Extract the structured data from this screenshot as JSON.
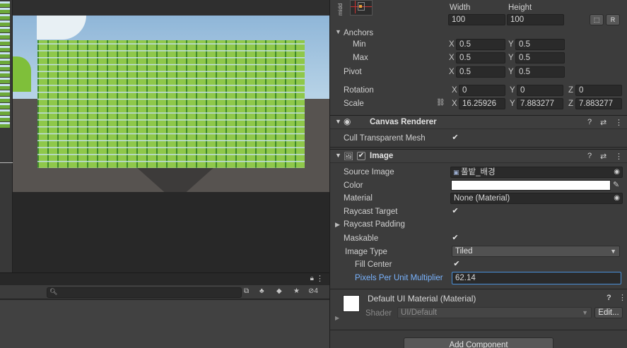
{
  "inspector": {
    "anchor_preset": {
      "label": "midd"
    },
    "rect": {
      "width_label": "Width",
      "height_label": "Height",
      "width": "100",
      "height": "100",
      "blueprint_button": "⬚",
      "raw_button": "R"
    },
    "anchors": {
      "label": "Anchors",
      "min_label": "Min",
      "min_x": "0.5",
      "min_y": "0.5",
      "max_label": "Max",
      "max_x": "0.5",
      "max_y": "0.5"
    },
    "pivot": {
      "label": "Pivot",
      "x": "0.5",
      "y": "0.5"
    },
    "rotation": {
      "label": "Rotation",
      "x": "0",
      "y": "0",
      "z": "0"
    },
    "scale": {
      "label": "Scale",
      "x": "16.25926",
      "y": "7.883277",
      "z": "7.883277"
    },
    "axes": {
      "x": "X",
      "y": "Y",
      "z": "Z"
    },
    "canvas_renderer": {
      "title": "Canvas Renderer",
      "cull_label": "Cull Transparent Mesh",
      "cull_checked": true
    },
    "image": {
      "title": "Image",
      "enabled": true,
      "source_image_label": "Source Image",
      "source_image_value": "풀밭_배경",
      "color_label": "Color",
      "color_value": "#ffffff",
      "material_label": "Material",
      "material_value": "None (Material)",
      "raycast_target_label": "Raycast Target",
      "raycast_target_checked": true,
      "raycast_padding_label": "Raycast Padding",
      "maskable_label": "Maskable",
      "maskable_checked": true,
      "image_type_label": "Image Type",
      "image_type_value": "Tiled",
      "fill_center_label": "Fill Center",
      "fill_center_checked": true,
      "ppu_label": "Pixels Per Unit Multiplier",
      "ppu_value": "62.14"
    },
    "material_section": {
      "title": "Default UI Material (Material)",
      "shader_label": "Shader",
      "shader_value": "UI/Default",
      "edit_button": "Edit..."
    },
    "add_component": "Add Component"
  },
  "bottom_panel": {
    "hidden_count": "4"
  },
  "colors": {
    "inspector_bg": "#3c3c3c",
    "field_bg": "#2a2a2a",
    "accent_blue": "#7ab4ff",
    "field_focus": "#4a90d9"
  }
}
